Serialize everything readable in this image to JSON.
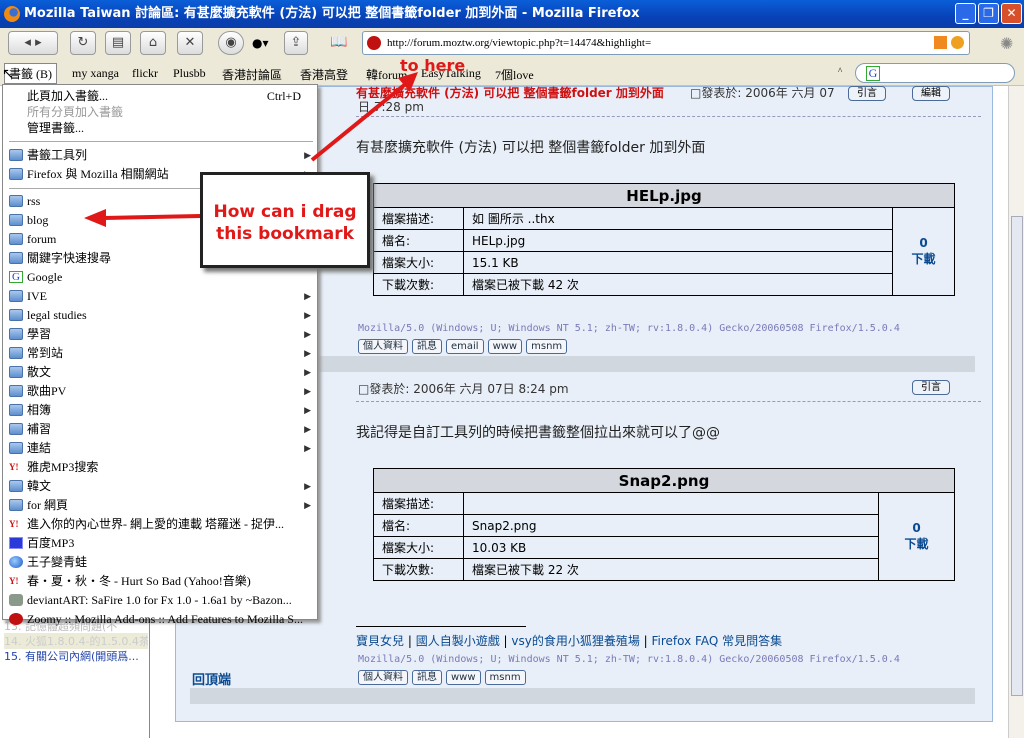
{
  "window": {
    "title": "Mozilla Taiwan 討論區: 有甚麼擴充軟件 (方法) 可以把 整個書籤folder 加到外面 - Mozilla Firefox"
  },
  "navbar": {
    "url": "http://forum.moztw.org/viewtopic.php?t=14474&highlight="
  },
  "bookmarks_bar": {
    "menu_label": "書籤 (B)",
    "items": [
      "my xanga",
      "flickr",
      "Plusbb",
      "香港討論區",
      "香港高登",
      "韓forum",
      "EasyTalking",
      "7個love"
    ]
  },
  "menu": {
    "top": [
      {
        "label": "此頁加入書籤...",
        "shortcut": "Ctrl+D"
      },
      {
        "label": "所有分頁加入書籤"
      },
      {
        "label": "管理書籤..."
      }
    ],
    "toolbar_items": [
      "書籤工具列",
      "Firefox 與 Mozilla 相關網站"
    ],
    "items": [
      {
        "label": "rss",
        "icon": "folder",
        "sub": false
      },
      {
        "label": "blog",
        "icon": "folder",
        "sub": false
      },
      {
        "label": "forum",
        "icon": "folder",
        "sub": false
      },
      {
        "label": "關鍵字快速搜尋",
        "icon": "folder",
        "sub": false
      },
      {
        "label": "Google",
        "icon": "google",
        "sub": false
      },
      {
        "label": "IVE",
        "icon": "folder",
        "sub": true
      },
      {
        "label": "legal studies",
        "icon": "folder",
        "sub": true
      },
      {
        "label": "學習",
        "icon": "folder",
        "sub": true
      },
      {
        "label": "常到站",
        "icon": "folder",
        "sub": true
      },
      {
        "label": "散文",
        "icon": "folder",
        "sub": true
      },
      {
        "label": "歌曲PV",
        "icon": "folder",
        "sub": true
      },
      {
        "label": "相簿",
        "icon": "folder",
        "sub": true
      },
      {
        "label": "補習",
        "icon": "folder",
        "sub": true
      },
      {
        "label": "連結",
        "icon": "folder",
        "sub": true
      },
      {
        "label": "雅虎MP3搜索",
        "icon": "yahoo",
        "sub": false
      },
      {
        "label": "韓文",
        "icon": "folder",
        "sub": true
      },
      {
        "label": "for 網頁",
        "icon": "folder",
        "sub": true
      },
      {
        "label": "進入你的內心世界- 網上愛的連載 塔羅迷 - 捉伊...",
        "icon": "yahoo",
        "sub": false
      },
      {
        "label": "百度MP3",
        "icon": "baidu",
        "sub": false
      },
      {
        "label": "王子變青蛙",
        "icon": "globe",
        "sub": false
      },
      {
        "label": "春・夏・秋・冬 - Hurt So Bad (Yahoo!音樂)",
        "icon": "yahoo",
        "sub": false
      },
      {
        "label": "deviantART: SaFire 1.0 for Fx 1.0 - 1.6a1 by ~Bazon...",
        "icon": "deviantart",
        "sub": false
      },
      {
        "label": "Zoomy :: Mozilla Add-ons :: Add Features to Mozilla S...",
        "icon": "mozilla",
        "sub": false
      }
    ]
  },
  "annotations": {
    "callout": "How can i drag this bookmark",
    "to_here": "to here"
  },
  "sidebar": {
    "items": [
      "13. 記憶體超頻問題(不",
      "14. 火狐1.8.0.4-的1.5.0.4茶",
      "15. 有關公司內網(開頭爲..."
    ]
  },
  "post1": {
    "title": "有甚麼擴充軟件 (方法) 可以把 整個書籤folder 加到外面",
    "posted": "□發表於: 2006年 六月 07",
    "posted2": "日 7:28 pm",
    "quote": "引言",
    "edit": "編輯",
    "body": "有甚麼擴充軟件 (方法) 可以把 整個書籤folder 加到外面",
    "attachment": {
      "name": "HELp.jpg",
      "rows": [
        [
          "檔案描述:",
          "如 圖所示 ..thx"
        ],
        [
          "檔名:",
          "HELp.jpg"
        ],
        [
          "檔案大小:",
          "15.1 KB"
        ],
        [
          "下載次數:",
          "檔案已被下載 42 次"
        ]
      ],
      "dl_count": "0",
      "dl_label": "下載"
    },
    "ua": "Mozilla/5.0 (Windows; U; Windows NT 5.1; zh-TW; rv:1.8.0.4) Gecko/20060508 Firefox/1.5.0.4",
    "buttons": [
      "個人資料",
      "訊息",
      "email",
      "www",
      "msnm"
    ]
  },
  "post2": {
    "posted": "□發表於: 2006年 六月 07日 8:24 pm",
    "quote": "引言",
    "body": "我記得是自訂工具列的時候把書籤整個拉出來就可以了@@",
    "attachment": {
      "name": "Snap2.png",
      "rows": [
        [
          "檔案描述:",
          ""
        ],
        [
          "檔名:",
          "Snap2.png"
        ],
        [
          "檔案大小:",
          "10.03 KB"
        ],
        [
          "下載次數:",
          "檔案已被下載 22 次"
        ]
      ],
      "dl_count": "0",
      "dl_label": "下載"
    },
    "sig_links": [
      "寶貝女兒",
      "國人自製小遊戲",
      "vsy的食用小狐狸養殖場",
      "Firefox FAQ 常見問答集"
    ],
    "ua": "Mozilla/5.0 (Windows; U; Windows NT 5.1; zh-TW; rv:1.8.0.4) Gecko/20060508 Firefox/1.5.0.4",
    "buttons": [
      "個人資料",
      "訊息",
      "www",
      "msnm"
    ],
    "back_to_top": "回頂端"
  }
}
